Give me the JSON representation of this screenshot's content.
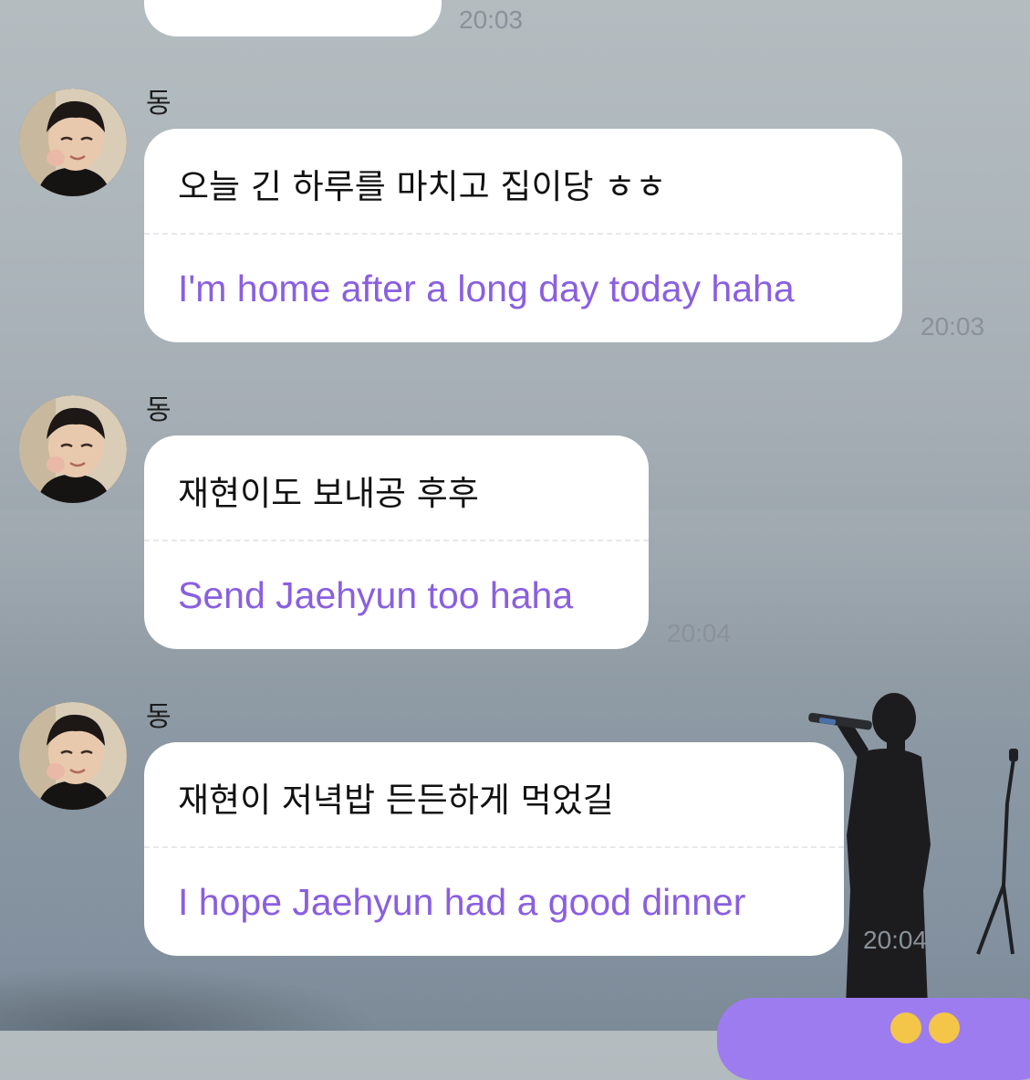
{
  "top_message": {
    "time": "20:03"
  },
  "messages": [
    {
      "sender": "동",
      "korean": "오늘 긴 하루를 마치고 집이당 ㅎㅎ",
      "translation": "I'm home after a long day today haha",
      "time": "20:03"
    },
    {
      "sender": "동",
      "korean": "재현이도 보내공 후후",
      "translation": "Send Jaehyun too haha",
      "time": "20:04"
    },
    {
      "sender": "동",
      "korean": "재현이 저녁밥 든든하게 먹었길",
      "translation": "I hope Jaehyun had a good dinner",
      "time": "20:04"
    }
  ],
  "colors": {
    "translation_text": "#8a5fe0",
    "outgoing_bubble": "#9d7cf0",
    "timestamp": "#8a9199"
  }
}
